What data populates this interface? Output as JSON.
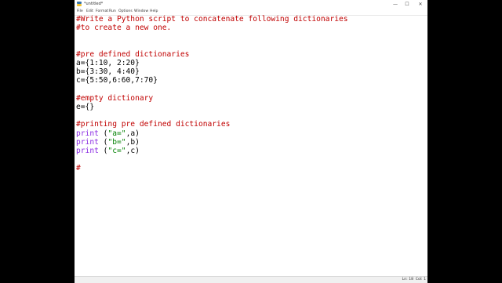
{
  "window": {
    "title": "*untitled*",
    "minimize_glyph": "—",
    "maximize_glyph": "☐",
    "close_glyph": "✕"
  },
  "menu": [
    "File",
    "Edit",
    "Format",
    "Run",
    "Options",
    "Window",
    "Help"
  ],
  "editor": {
    "lines": [
      {
        "segments": [
          {
            "t": "#Write a Python script to concatenate following dictionaries",
            "k": "comment"
          }
        ]
      },
      {
        "segments": [
          {
            "t": "#to create a new one.",
            "k": "comment"
          }
        ]
      },
      {
        "segments": []
      },
      {
        "segments": []
      },
      {
        "segments": [
          {
            "t": "#pre defined dictionaries",
            "k": "comment"
          }
        ]
      },
      {
        "segments": [
          {
            "t": "a={1:10, 2:20}",
            "k": "plain"
          }
        ]
      },
      {
        "segments": [
          {
            "t": "b={3:30, 4:40}",
            "k": "plain"
          }
        ]
      },
      {
        "segments": [
          {
            "t": "c={5:50,6:60,7:70}",
            "k": "plain"
          }
        ]
      },
      {
        "segments": []
      },
      {
        "segments": [
          {
            "t": "#empty dictionary",
            "k": "comment"
          }
        ]
      },
      {
        "segments": [
          {
            "t": "e={}",
            "k": "plain"
          }
        ]
      },
      {
        "segments": []
      },
      {
        "segments": [
          {
            "t": "#printing pre defined dictionaries",
            "k": "comment"
          }
        ]
      },
      {
        "segments": [
          {
            "t": "print",
            "k": "builtin"
          },
          {
            "t": " (",
            "k": "plain"
          },
          {
            "t": "\"a=\"",
            "k": "string"
          },
          {
            "t": ",a)",
            "k": "plain"
          }
        ]
      },
      {
        "segments": [
          {
            "t": "print",
            "k": "builtin"
          },
          {
            "t": " (",
            "k": "plain"
          },
          {
            "t": "\"b=\"",
            "k": "string"
          },
          {
            "t": ",b)",
            "k": "plain"
          }
        ]
      },
      {
        "segments": [
          {
            "t": "print",
            "k": "builtin"
          },
          {
            "t": " (",
            "k": "plain"
          },
          {
            "t": "\"c=\"",
            "k": "string"
          },
          {
            "t": ",c)",
            "k": "plain"
          }
        ]
      },
      {
        "segments": []
      },
      {
        "segments": [
          {
            "t": "#",
            "k": "comment"
          }
        ]
      }
    ]
  },
  "status": {
    "line": "Ln: 18",
    "col": "Col: 1"
  },
  "colors": {
    "comment": "#c00000",
    "builtin": "#8a2be2",
    "string": "#008000",
    "plain": "#000000"
  }
}
